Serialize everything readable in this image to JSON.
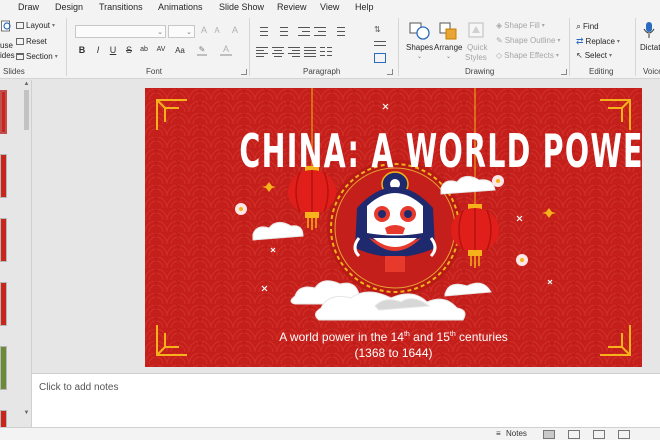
{
  "tabs": [
    "Draw",
    "Design",
    "Transitions",
    "Animations",
    "Slide Show",
    "Review",
    "View",
    "Help"
  ],
  "ribbon": {
    "slides": {
      "new_slide_partial": "use\nides",
      "layout": "Layout",
      "reset": "Reset",
      "section": "Section",
      "group": "Slides"
    },
    "font": {
      "group": "Font",
      "grow": "A",
      "shrink": "A",
      "clear": "A",
      "bold": "B",
      "italic": "I",
      "underline": "U",
      "strike": "S",
      "shadow": "ab",
      "spacing": "AV",
      "case": "Aa",
      "font_color": "A"
    },
    "paragraph": {
      "group": "Paragraph"
    },
    "drawing": {
      "group": "Drawing",
      "shapes": "Shapes",
      "arrange": "Arrange",
      "quick_styles_1": "Quick",
      "quick_styles_2": "Styles",
      "shape_fill": "Shape Fill",
      "shape_outline": "Shape Outline",
      "shape_effects": "Shape Effects"
    },
    "editing": {
      "group": "Editing",
      "find": "Find",
      "replace": "Replace",
      "select": "Select"
    },
    "voice": {
      "group": "Voice",
      "dictate": "Dictate"
    }
  },
  "slide": {
    "title": "CHINA: A WORLD POWER",
    "subtitle_pre": "A world power in the 14",
    "sup1": "th",
    "subtitle_mid": " and 15",
    "sup2": "th",
    "subtitle_post": "  centuries",
    "subtitle_line2": "(1368 to 1644)"
  },
  "notes": {
    "placeholder": "Click to add notes"
  },
  "status": {
    "notes": "Notes"
  },
  "colors": {
    "slide_red": "#c41f1a",
    "gold": "#f5b21a",
    "accent": "#c0504d"
  }
}
